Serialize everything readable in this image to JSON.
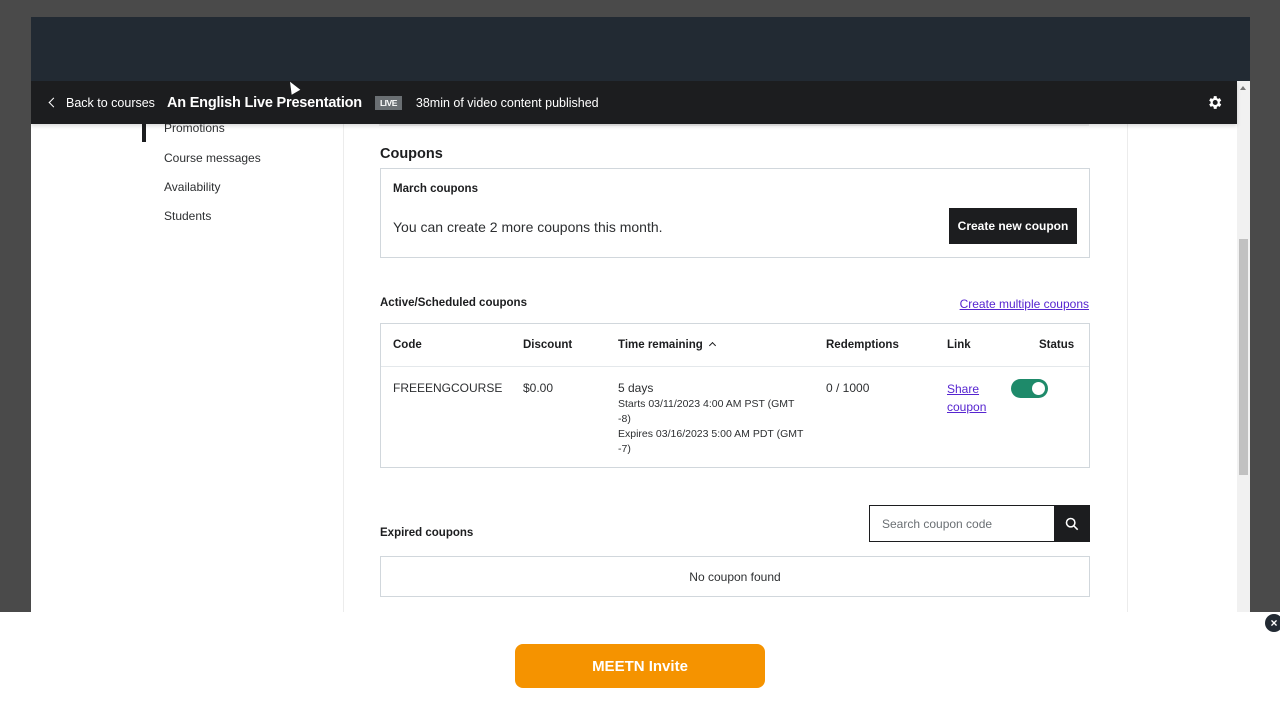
{
  "header": {
    "back_label": "Back to courses",
    "course_title": "An English Live Presentation",
    "live_badge": "LIVE",
    "published_text": "38min of video content published"
  },
  "sidebar": {
    "items": [
      {
        "label": "Promotions",
        "active": true
      },
      {
        "label": "Course messages",
        "active": false
      },
      {
        "label": "Availability",
        "active": false
      },
      {
        "label": "Students",
        "active": false
      }
    ]
  },
  "coupons": {
    "title": "Coupons",
    "monthly": {
      "title": "March coupons",
      "text": "You can create 2 more coupons this month.",
      "create_button": "Create new coupon"
    },
    "active": {
      "title": "Active/Scheduled coupons",
      "create_multiple_link": "Create multiple coupons",
      "columns": [
        "Code",
        "Discount",
        "Time remaining",
        "Redemptions",
        "Link",
        "Status"
      ],
      "sort_column": "Time remaining",
      "rows": [
        {
          "code": "FREEENGCOURSE",
          "discount": "$0.00",
          "time_remaining": "5 days",
          "starts": "Starts 03/11/2023 4:00 AM PST (GMT -8)",
          "expires": "Expires 03/16/2023 5:00 AM PDT (GMT -7)",
          "redemptions": "0 / 1000",
          "link_label": "Share coupon",
          "status_on": true
        }
      ]
    },
    "expired": {
      "title": "Expired coupons",
      "search_placeholder": "Search coupon code",
      "empty_text": "No coupon found"
    }
  },
  "overlay": {
    "invite_button": "MEETN Invite",
    "close_label": "×"
  },
  "colors": {
    "header_bg": "#1c1d1f",
    "link": "#5624d0",
    "toggle_on": "#1e8a6a",
    "invite_orange": "#f59300"
  }
}
